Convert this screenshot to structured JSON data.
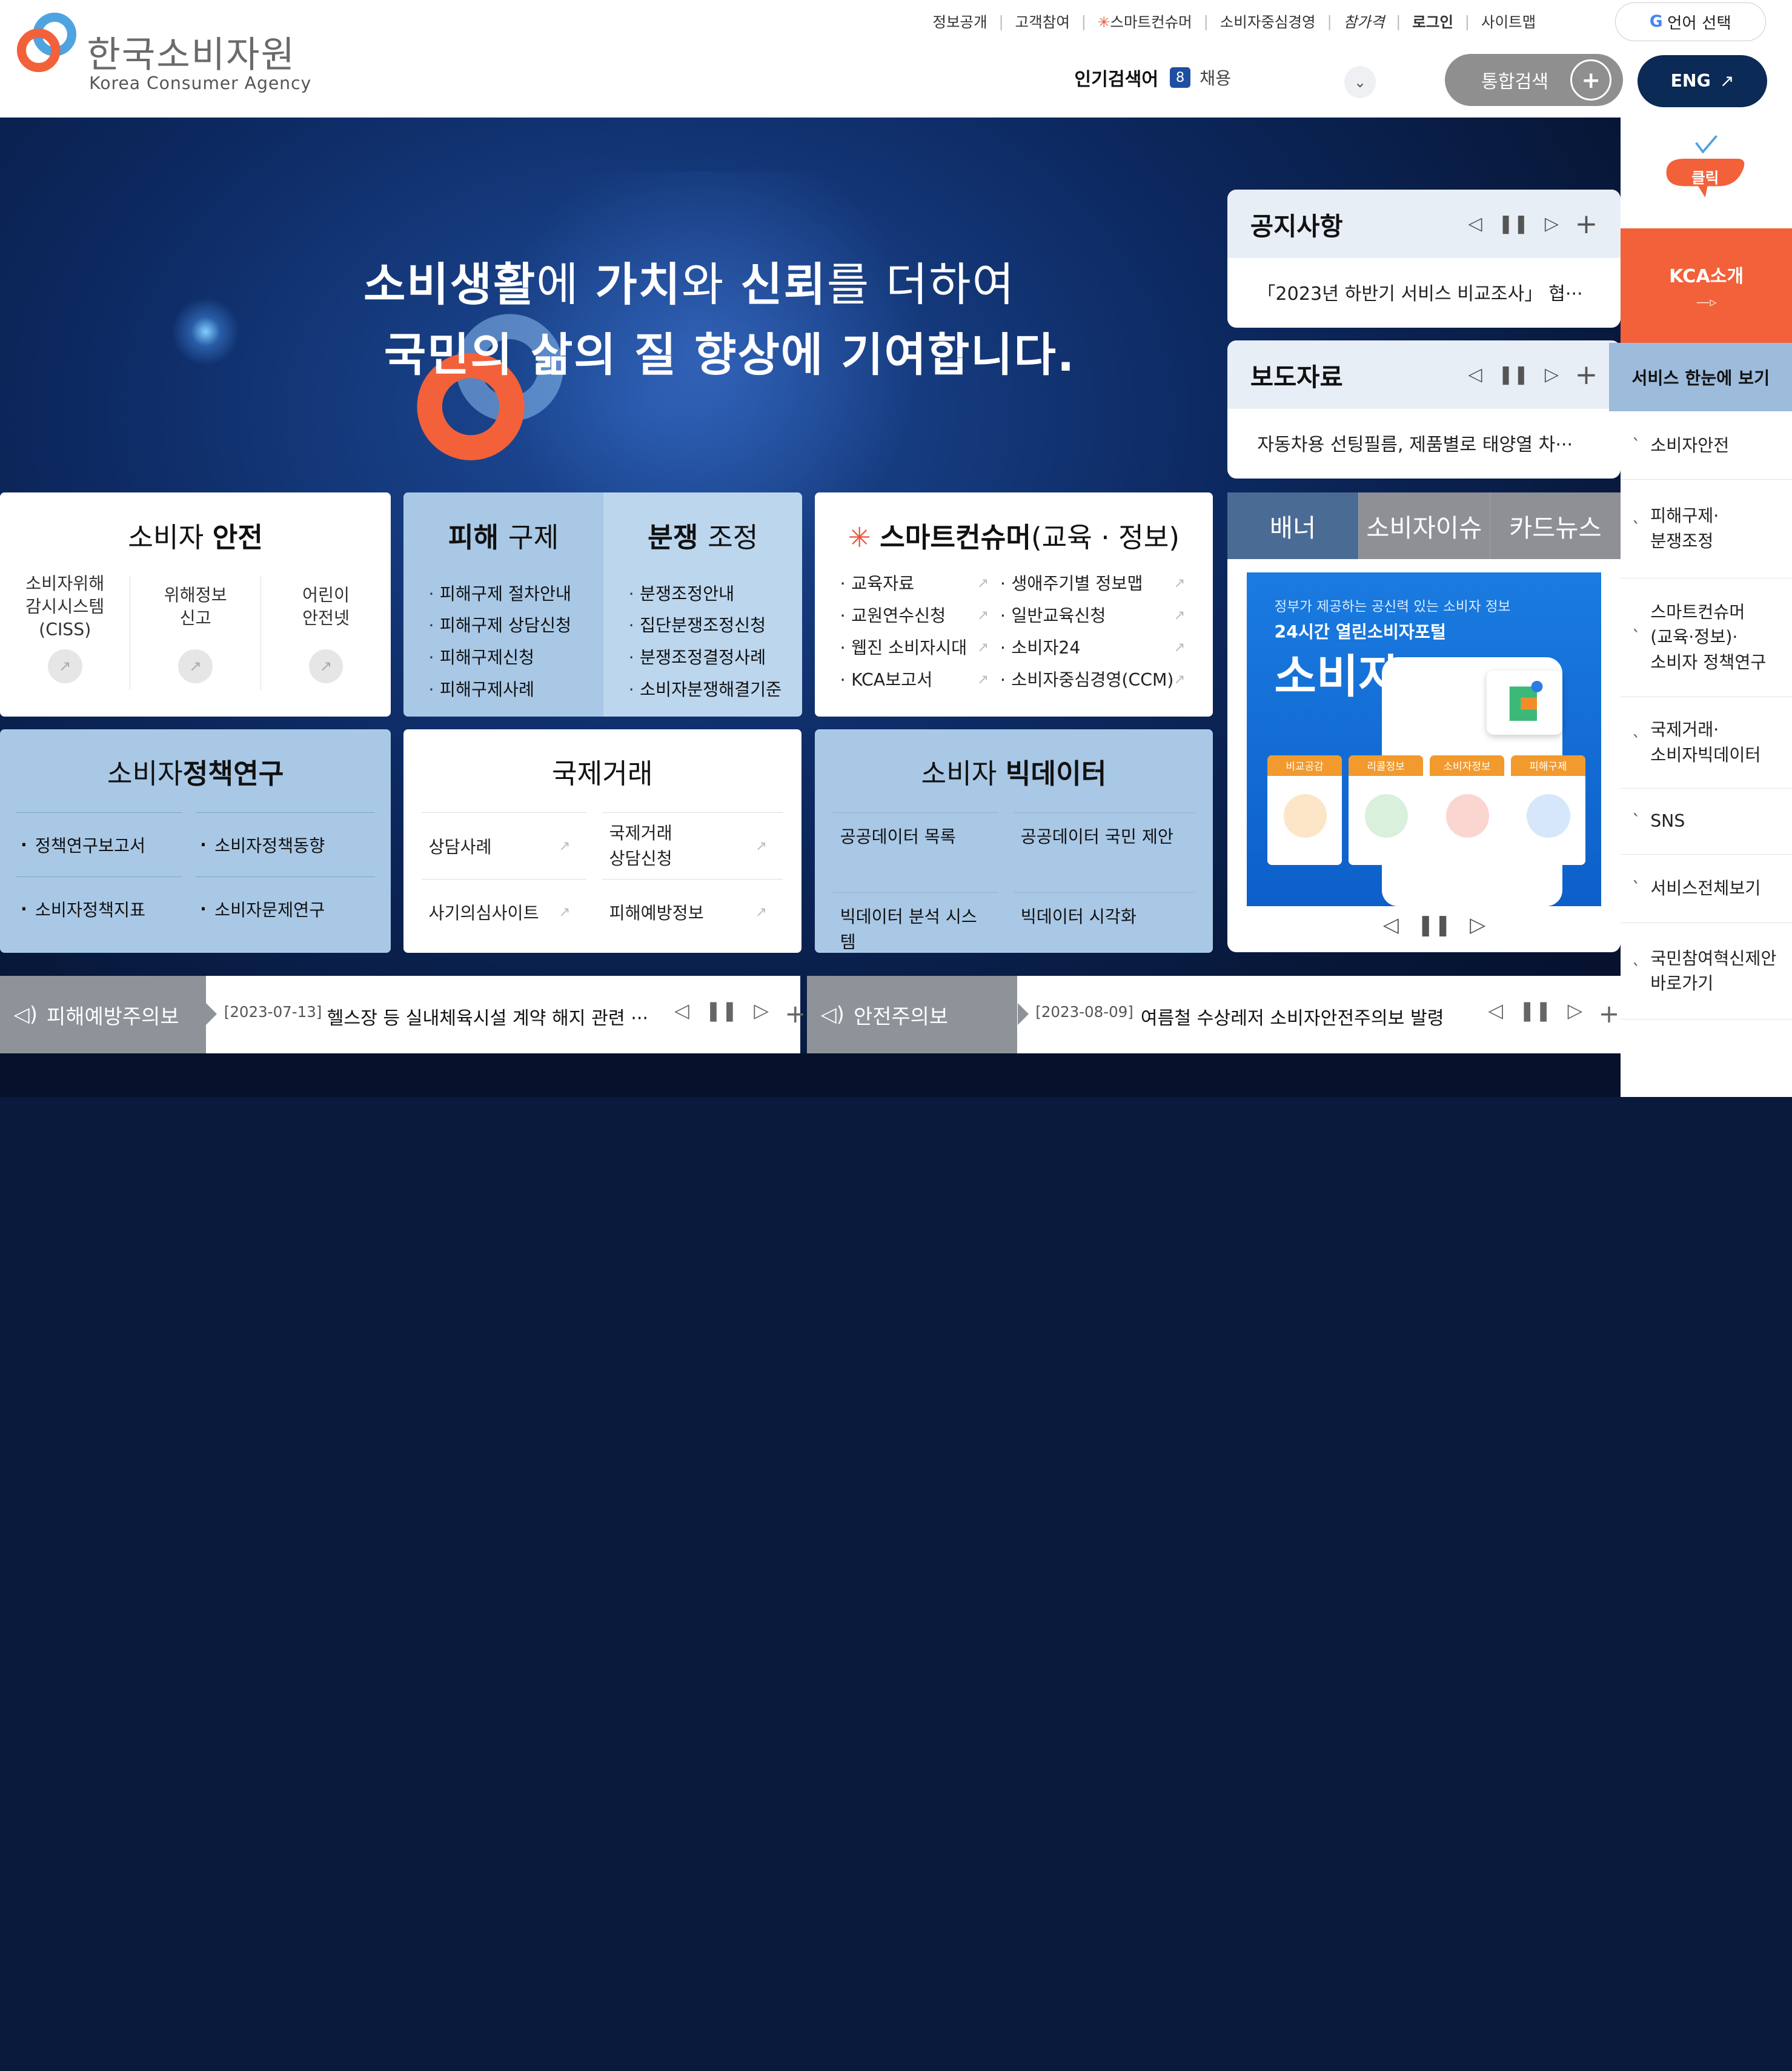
{
  "header": {
    "logo_ko": "한국소비자원",
    "logo_en": "Korea Consumer Agency",
    "utility": [
      "정보공개",
      "고객참여",
      "스마트컨슈머",
      "소비자중심경영",
      "참가격",
      "로그인",
      "사이트맵"
    ],
    "language_label": "언어 선택",
    "popular_label": "인기검색어",
    "popular_rank": "8",
    "popular_keyword": "채용",
    "search_label": "통합검색",
    "eng_label": "ENG"
  },
  "hero": {
    "line1_a": "소비생활",
    "line1_b": "에 ",
    "line1_c": "가치",
    "line1_d": "와 ",
    "line1_e": "신뢰",
    "line1_f": "를 더하여",
    "line2": "국민의 삶의 질 향상에 기여합니다."
  },
  "notice": {
    "title": "공지사항",
    "item": "「2023년 하반기 서비스 비교조사」 협···"
  },
  "press": {
    "title": "보도자료",
    "item": "자동차용 선팅필름, 제품별로 태양열 차···"
  },
  "safety": {
    "title_a": "소비자 ",
    "title_b": "안전",
    "items": [
      "소비자위해\n감시시스템\n(CISS)",
      "위해정보\n신고",
      "어린이\n안전넷"
    ]
  },
  "relief": {
    "title_a": "피해 ",
    "title_b": "구제",
    "items": [
      "피해구제 절차안내",
      "피해구제 상담신청",
      "피해구제신청",
      "피해구제사례"
    ]
  },
  "dispute": {
    "title_a": "분쟁 ",
    "title_b": "조정",
    "items": [
      "분쟁조정안내",
      "집단분쟁조정신청",
      "분쟁조정결정사례",
      "소비자분쟁해결기준"
    ]
  },
  "smart": {
    "title_a": "스마트컨슈머",
    "title_b": "(교육 · 정보)",
    "items": [
      "교육자료",
      "생애주기별 정보맵",
      "교원연수신청",
      "일반교육신청",
      "웹진 소비자시대",
      "소비자24",
      "KCA보고서",
      "소비자중심경영(CCM)"
    ]
  },
  "policy": {
    "title_a": "소비자",
    "title_b": "정책연구",
    "items": [
      "정책연구보고서",
      "소비자정책동향",
      "소비자정책지표",
      "소비자문제연구"
    ]
  },
  "intl": {
    "title": "국제거래",
    "items": [
      "상담사례",
      "국제거래\n상담신청",
      "사기의심사이트",
      "피해예방정보"
    ]
  },
  "bigdata": {
    "title_a": "소비자 ",
    "title_b": "빅데이터",
    "items": [
      "공공데이터 목록",
      "공공데이터 국민 제안",
      "빅데이터 분석 시스템",
      "빅데이터 시각화"
    ]
  },
  "banner": {
    "tabs": [
      "배너",
      "소비자이슈",
      "카드뉴스"
    ],
    "small": "정부가 제공하는 공신력 있는 소비자 정보",
    "medium": "24시간 열린소비자포털",
    "large": "소비자24",
    "cards": [
      "비교공감",
      "리콜정보",
      "소비자정보",
      "피해구제"
    ]
  },
  "alerts": [
    {
      "label": "피해예방주의보",
      "date": "[2023-07-13]",
      "text": "헬스장 등 실내체육시설 계약 해지 관련 ···"
    },
    {
      "label": "안전주의보",
      "date": "[2023-08-09]",
      "text": "여름철 수상레저 소비자안전주의보 발령"
    }
  ],
  "side": {
    "click": "클릭",
    "kca": "KCA소개",
    "service": "서비스 한눈에 보기",
    "items": [
      "소비자안전",
      "피해구제·\n분쟁조정",
      "스마트컨슈머\n(교육·정보)·\n소비자 정책연구",
      "국제거래·\n소비자빅데이터",
      "SNS",
      "서비스전체보기",
      "국민참여혁신제안\n바로가기"
    ]
  },
  "colors": {
    "brand_orange": "#f2613a",
    "brand_blue": "#4fa3e0",
    "navy": "#0b2a55",
    "tile_blue": "#a9c8e6"
  }
}
